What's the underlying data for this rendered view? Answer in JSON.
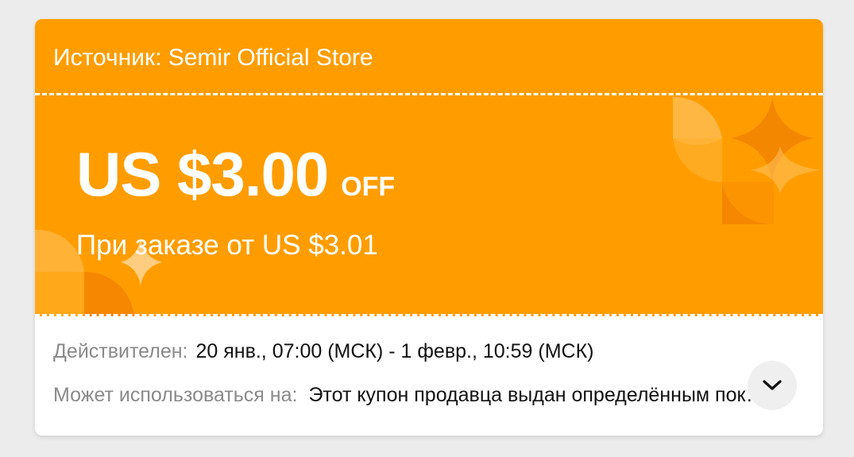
{
  "coupon": {
    "source": "Источник: Semir Official Store",
    "amount": "US $3.00",
    "off_label": "OFF",
    "min_order": "При заказе от US $3.01",
    "validity_label": "Действителен:",
    "validity_value": "20 янв., 07:00 (МСК) - 1 февр., 10:59 (МСК)",
    "usage_label": "Может использоваться на:",
    "usage_value": "Этот купон продавца выдан определённым покупателям и может использоваться только в указанном магазине",
    "expand_icon": "chevron-down-icon"
  },
  "colors": {
    "accent": "#ff9d00",
    "accent_dark": "#f07d00",
    "accent_light": "#ffc05a",
    "label_gray": "#8a8a8a",
    "text_dark": "#111111",
    "background": "#ececec"
  }
}
